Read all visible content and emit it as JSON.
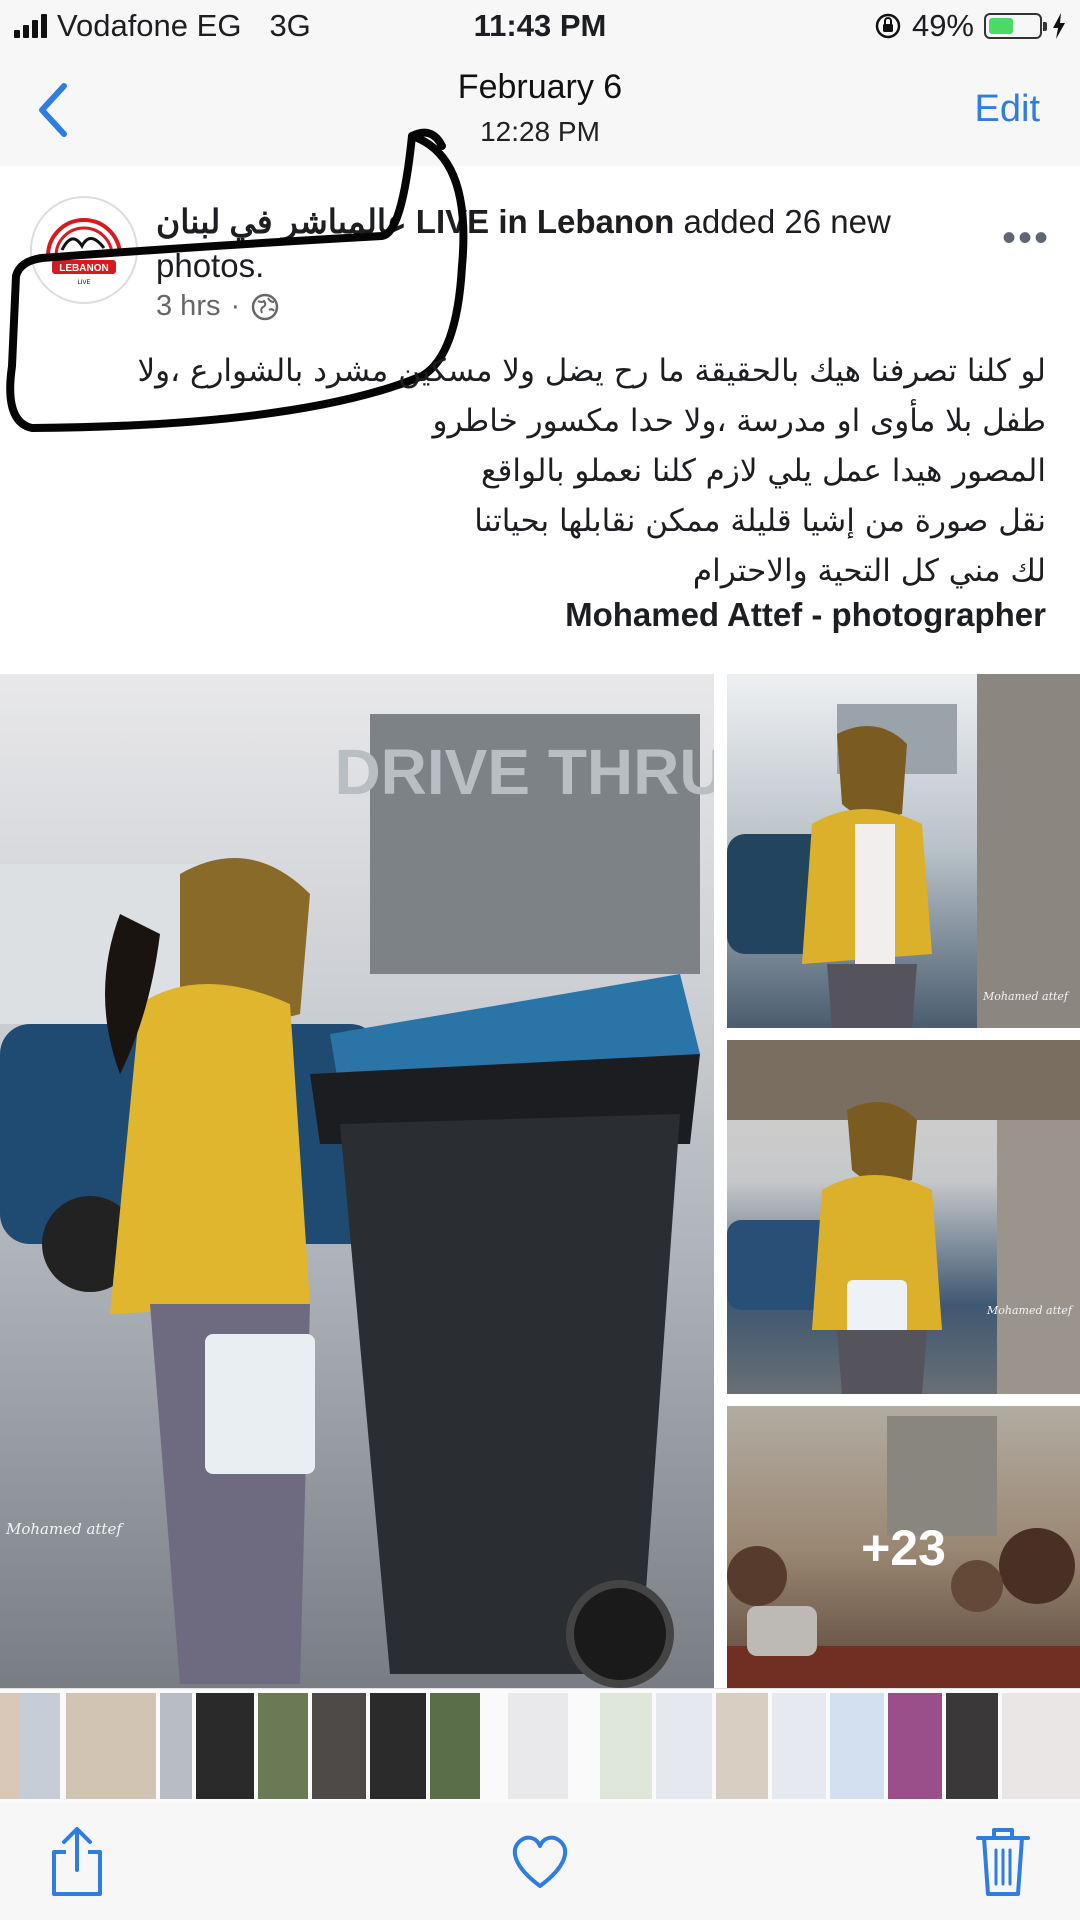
{
  "status_bar": {
    "carrier": "Vodafone EG",
    "network": "3G",
    "time": "11:43 PM",
    "battery_percent": "49%",
    "battery_level": 0.49
  },
  "nav": {
    "back_label": "Back",
    "title": "February 6",
    "subtitle": "12:28 PM",
    "edit_label": "Edit"
  },
  "post": {
    "author": "عالمباشر في لبنان LIVE in Lebanon",
    "action": "added 26 new photos.",
    "age": "3 hrs",
    "privacy_icon": "globe-icon",
    "avatar_text": "LEBANON",
    "avatar_subtext": "LIVE",
    "body_lines": [
      "لو كلنا تصرفنا هيك بالحقيقة ما رح يضل ولا مسكين مشرد بالشوارع ،ولا",
      "طفل بلا مأوى او مدرسة ،ولا حدا مكسور خاطرو",
      "المصور هيدا عمل يلي لازم كلنا نعملو بالواقع",
      "نقل صورة من إشيا قليلة ممكن نقابلها بحياتنا",
      "لك مني كل التحية والاحترام"
    ],
    "credit": "Mohamed Attef - photographer",
    "photos": {
      "main_sign": "DRIVE THRU",
      "watermark": "Mohamed attef",
      "more_count": "+23"
    }
  },
  "toolbar": {
    "share_icon": "share-icon",
    "like_icon": "heart-icon",
    "delete_icon": "trash-icon"
  },
  "colors": {
    "accent": "#2f7de1",
    "battery_green": "#4cd964"
  }
}
